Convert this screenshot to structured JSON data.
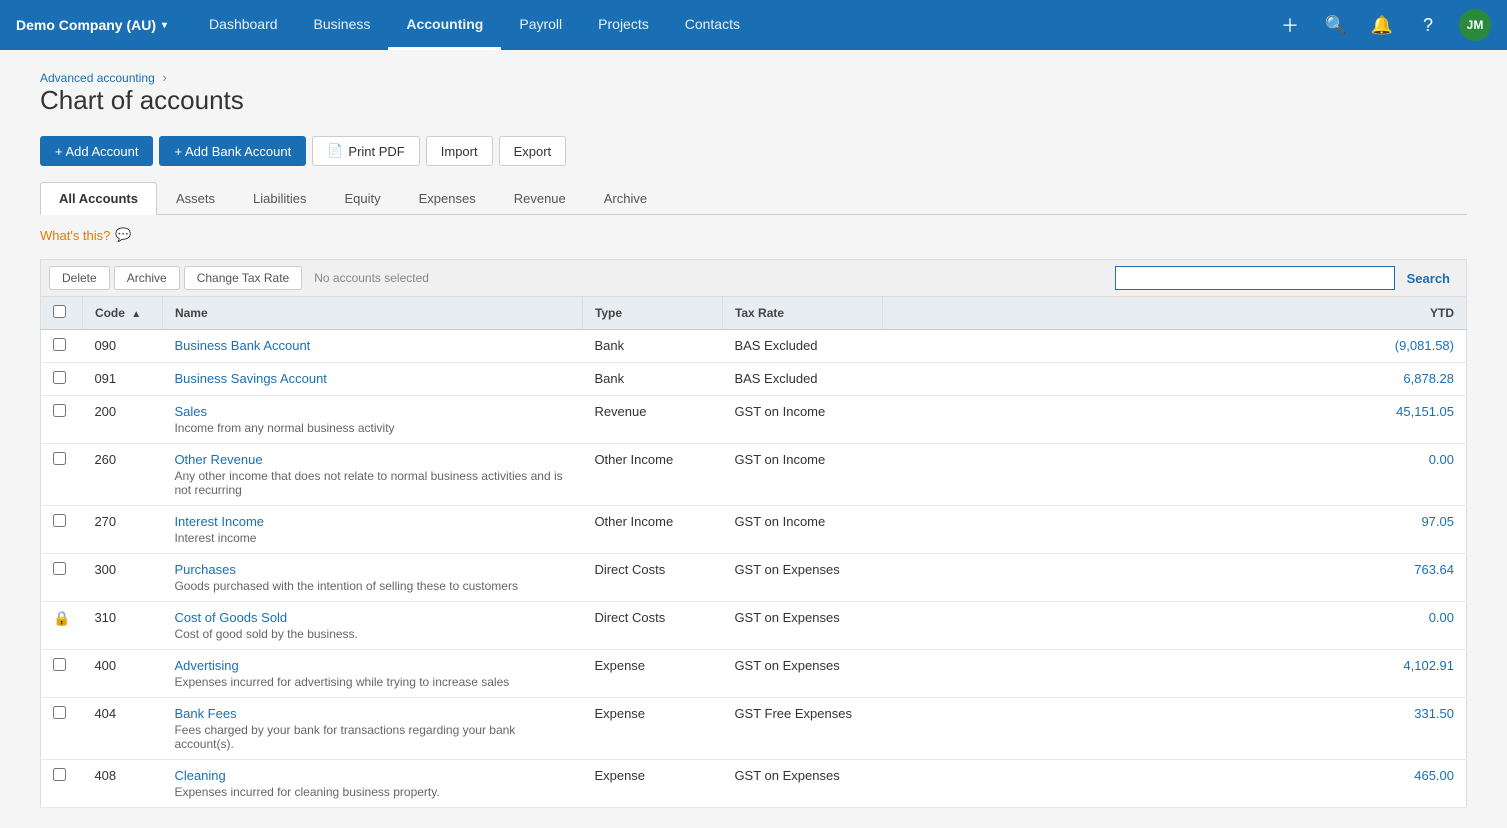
{
  "company": {
    "name": "Demo Company (AU)",
    "avatar": "JM"
  },
  "nav": {
    "items": [
      {
        "id": "dashboard",
        "label": "Dashboard",
        "active": false
      },
      {
        "id": "business",
        "label": "Business",
        "active": false
      },
      {
        "id": "accounting",
        "label": "Accounting",
        "active": true
      },
      {
        "id": "payroll",
        "label": "Payroll",
        "active": false
      },
      {
        "id": "projects",
        "label": "Projects",
        "active": false
      },
      {
        "id": "contacts",
        "label": "Contacts",
        "active": false
      }
    ]
  },
  "breadcrumb": {
    "parent": "Advanced accounting",
    "current": "Chart of accounts"
  },
  "page": {
    "title": "Chart of accounts"
  },
  "buttons": {
    "add_account": "+ Add Account",
    "add_bank_account": "+ Add Bank Account",
    "print_pdf": "Print PDF",
    "import": "Import",
    "export": "Export"
  },
  "tabs": [
    {
      "id": "all",
      "label": "All Accounts",
      "active": true
    },
    {
      "id": "assets",
      "label": "Assets",
      "active": false
    },
    {
      "id": "liabilities",
      "label": "Liabilities",
      "active": false
    },
    {
      "id": "equity",
      "label": "Equity",
      "active": false
    },
    {
      "id": "expenses",
      "label": "Expenses",
      "active": false
    },
    {
      "id": "revenue",
      "label": "Revenue",
      "active": false
    },
    {
      "id": "archive",
      "label": "Archive",
      "active": false
    }
  ],
  "whats_this": "What's this?",
  "toolbar": {
    "delete_label": "Delete",
    "archive_label": "Archive",
    "change_tax_rate_label": "Change Tax Rate",
    "no_selected": "No accounts selected",
    "search_label": "Search",
    "search_placeholder": ""
  },
  "table": {
    "columns": {
      "checkbox": "",
      "code": "Code",
      "name": "Name",
      "type": "Type",
      "tax_rate": "Tax Rate",
      "ytd": "YTD"
    },
    "rows": [
      {
        "id": "row-090",
        "locked": false,
        "code": "090",
        "name": "Business Bank Account",
        "description": "",
        "type": "Bank",
        "tax_rate": "BAS Excluded",
        "ytd": "(9,081.58)",
        "ytd_negative": true
      },
      {
        "id": "row-091",
        "locked": false,
        "code": "091",
        "name": "Business Savings Account",
        "description": "",
        "type": "Bank",
        "tax_rate": "BAS Excluded",
        "ytd": "6,878.28",
        "ytd_negative": false
      },
      {
        "id": "row-200",
        "locked": false,
        "code": "200",
        "name": "Sales",
        "description": "Income from any normal business activity",
        "type": "Revenue",
        "tax_rate": "GST on Income",
        "ytd": "45,151.05",
        "ytd_negative": false
      },
      {
        "id": "row-260",
        "locked": false,
        "code": "260",
        "name": "Other Revenue",
        "description": "Any other income that does not relate to normal business activities and is not recurring",
        "type": "Other Income",
        "tax_rate": "GST on Income",
        "ytd": "0.00",
        "ytd_negative": false
      },
      {
        "id": "row-270",
        "locked": false,
        "code": "270",
        "name": "Interest Income",
        "description": "Interest income",
        "type": "Other Income",
        "tax_rate": "GST on Income",
        "ytd": "97.05",
        "ytd_negative": false
      },
      {
        "id": "row-300",
        "locked": false,
        "code": "300",
        "name": "Purchases",
        "description": "Goods purchased with the intention of selling these to customers",
        "type": "Direct Costs",
        "tax_rate": "GST on Expenses",
        "ytd": "763.64",
        "ytd_negative": false
      },
      {
        "id": "row-310",
        "locked": true,
        "code": "310",
        "name": "Cost of Goods Sold",
        "description": "Cost of good sold by the business.",
        "type": "Direct Costs",
        "tax_rate": "GST on Expenses",
        "ytd": "0.00",
        "ytd_negative": false
      },
      {
        "id": "row-400",
        "locked": false,
        "code": "400",
        "name": "Advertising",
        "description": "Expenses incurred for advertising while trying to increase sales",
        "type": "Expense",
        "tax_rate": "GST on Expenses",
        "ytd": "4,102.91",
        "ytd_negative": false
      },
      {
        "id": "row-404",
        "locked": false,
        "code": "404",
        "name": "Bank Fees",
        "description": "Fees charged by your bank for transactions regarding your bank account(s).",
        "type": "Expense",
        "tax_rate": "GST Free Expenses",
        "ytd": "331.50",
        "ytd_negative": false
      },
      {
        "id": "row-408",
        "locked": false,
        "code": "408",
        "name": "Cleaning",
        "description": "Expenses incurred for cleaning business property.",
        "type": "Expense",
        "tax_rate": "GST on Expenses",
        "ytd": "465.00",
        "ytd_negative": false
      }
    ]
  }
}
